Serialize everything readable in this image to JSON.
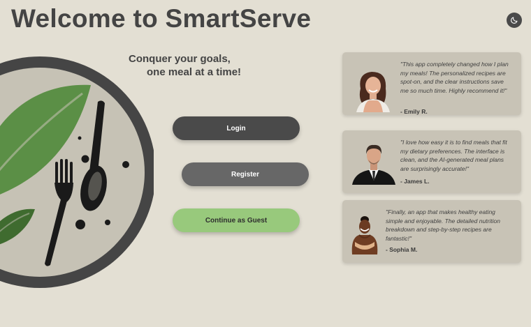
{
  "header": {
    "title": "Welcome to SmartServe",
    "theme_toggle_icon": "moon-icon"
  },
  "logo": {
    "icon": "plate-fork-spoon-leaf-logo",
    "colors": {
      "rim": "#454545",
      "plate": "#c6c2b5",
      "leaf_light": "#5b8f46",
      "leaf_dark": "#3f6b2f",
      "utensils": "#1a1a1a"
    }
  },
  "hero": {
    "tagline_line1": "Conquer your goals,",
    "tagline_line2": "one meal at a time!"
  },
  "actions": {
    "login_label": "Login",
    "register_label": "Register",
    "guest_label": "Continue as Guest"
  },
  "testimonials": [
    {
      "quote": "\"This app completely changed how I plan my meals! The personalized recipes are spot-on, and the clear instructions save me so much time. Highly recommend it!\"",
      "author": "- Emily R."
    },
    {
      "quote": "\"I love how easy it is to find meals that fit my dietary preferences. The interface is clean, and the AI-generated meal plans are surprisingly accurate!\"",
      "author": "- James L."
    },
    {
      "quote": "\"Finally, an app that makes healthy eating simple and enjoyable. The detailed nutrition breakdown and step-by-step recipes are fantastic!\"",
      "author": "- Sophia M."
    }
  ],
  "colors": {
    "background": "#e3dfd3",
    "card": "#c8c3b6",
    "login_button": "#4a4a4a",
    "register_button": "#676767",
    "guest_button": "#98c97c"
  }
}
